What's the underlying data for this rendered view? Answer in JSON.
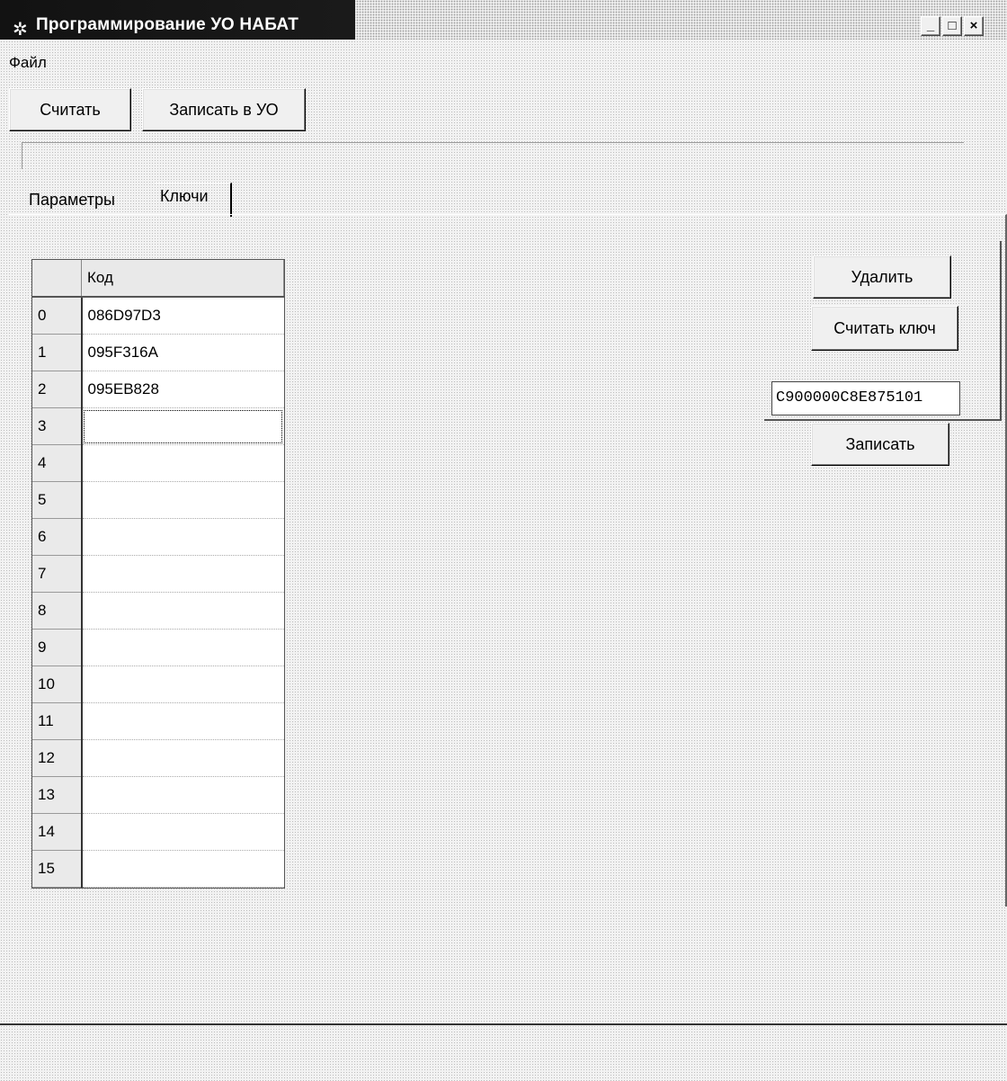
{
  "window": {
    "title": "Программирование УО НАБАТ",
    "icon": "gear-icon",
    "controls": {
      "minimize": "_",
      "maximize": "□",
      "close": "×"
    }
  },
  "menu": {
    "file": "Файл"
  },
  "toolbar": {
    "read_label": "Считать",
    "write_label": "Записать в УО"
  },
  "tabs": [
    {
      "label": "Параметры",
      "active": false
    },
    {
      "label": "Ключи",
      "active": true
    }
  ],
  "keys_table": {
    "column_header": "Код",
    "rows": [
      {
        "index": "0",
        "code": "086D97D3"
      },
      {
        "index": "1",
        "code": "095F316A"
      },
      {
        "index": "2",
        "code": "095EB828"
      },
      {
        "index": "3",
        "code": ""
      },
      {
        "index": "4",
        "code": ""
      },
      {
        "index": "5",
        "code": ""
      },
      {
        "index": "6",
        "code": ""
      },
      {
        "index": "7",
        "code": ""
      },
      {
        "index": "8",
        "code": ""
      },
      {
        "index": "9",
        "code": ""
      },
      {
        "index": "10",
        "code": ""
      },
      {
        "index": "11",
        "code": ""
      },
      {
        "index": "12",
        "code": ""
      },
      {
        "index": "13",
        "code": ""
      },
      {
        "index": "14",
        "code": ""
      },
      {
        "index": "15",
        "code": ""
      }
    ]
  },
  "key_panel": {
    "delete_label": "Удалить",
    "read_key_label": "Считать ключ",
    "key_value": "C900000C8E875101",
    "write_label": "Записать"
  }
}
